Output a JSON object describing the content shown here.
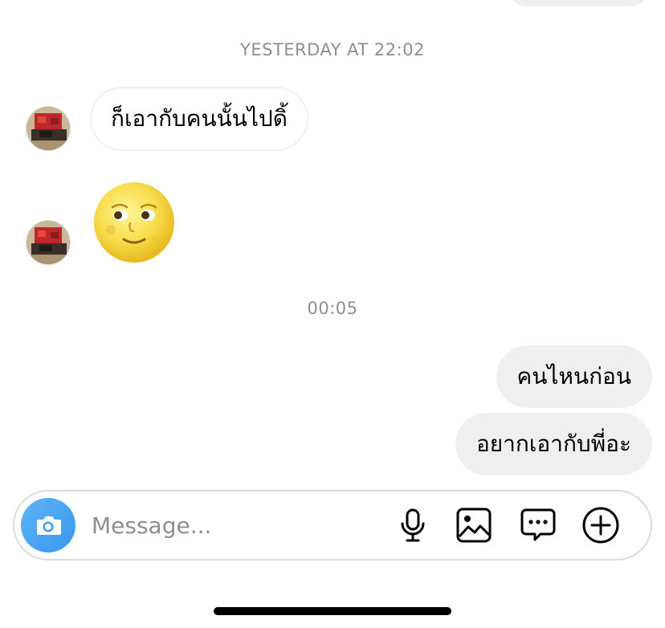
{
  "thread": {
    "timestamp_1": "YESTERDAY AT 22:02",
    "timestamp_2": "00:05",
    "incoming_message_1": "ก็เอากับคนนั้นไปดิ้",
    "incoming_emoji": "full-moon-face-emoji",
    "outgoing_message_1": "คนไหนก่อน",
    "outgoing_message_2": "อยากเอากับพี่อะ"
  },
  "composer": {
    "placeholder": "Message...",
    "icons": [
      "camera-icon",
      "microphone-icon",
      "gallery-icon",
      "sticker-chat-icon",
      "plus-icon"
    ],
    "camera_color": "#3897f0"
  },
  "colors": {
    "bubble_incoming_border": "#efefef",
    "bubble_outgoing_bg": "#efefef",
    "timestamp": "#8e8e8e"
  }
}
